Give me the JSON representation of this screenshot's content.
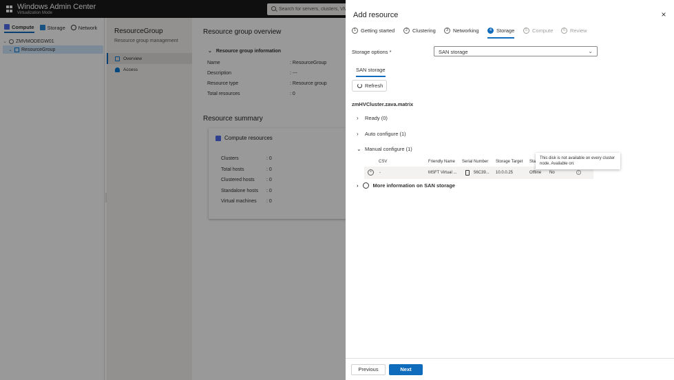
{
  "app": {
    "title": "Windows Admin Center",
    "subtitle": "Virtualization Mode",
    "search_placeholder": "Search for servers, clusters, VMs"
  },
  "left_nav": {
    "tabs": [
      {
        "label": "Compute",
        "icon": "compute-icon",
        "active": true
      },
      {
        "label": "Storage",
        "icon": "storage-icon",
        "active": false
      },
      {
        "label": "Network",
        "icon": "network-icon",
        "active": false
      }
    ],
    "tree": [
      {
        "label": "ZMVMODEGW01",
        "icon": "server-icon",
        "expanded": true
      },
      {
        "label": "ResourceGroup",
        "icon": "resource-group-icon",
        "selected": true
      }
    ]
  },
  "resource_nav": {
    "title": "ResourceGroup",
    "subtitle": "Resource group management",
    "items": [
      {
        "label": "Overview",
        "icon": "overview-icon",
        "active": true
      },
      {
        "label": "Access",
        "icon": "access-icon",
        "active": false
      }
    ]
  },
  "overview": {
    "title": "Resource group overview",
    "info_header": "Resource group information",
    "fields": [
      {
        "key": "Name",
        "value": ": ResourceGroup"
      },
      {
        "key": "Description",
        "value": ": ---"
      },
      {
        "key": "Resource type",
        "value": ": Resource group"
      },
      {
        "key": "Total resources",
        "value": ": 0"
      }
    ],
    "summary_title": "Resource summary",
    "compute_card": {
      "title": "Compute resources",
      "rows": [
        {
          "key": "Clusters",
          "value": ": 0"
        },
        {
          "key": "Total hosts",
          "value": ": 0"
        },
        {
          "key": "Clustered hosts",
          "value": ": 0"
        },
        {
          "key": "Standalone hosts",
          "value": ": 0"
        },
        {
          "key": "Virtual machines",
          "value": ": 0"
        }
      ]
    }
  },
  "panel": {
    "title": "Add resource",
    "close_label": "×",
    "steps": [
      {
        "num": "1",
        "label": "Getting started",
        "state": "done"
      },
      {
        "num": "2",
        "label": "Clustering",
        "state": "done"
      },
      {
        "num": "3",
        "label": "Networking",
        "state": "done"
      },
      {
        "num": "4",
        "label": "Storage",
        "state": "current"
      },
      {
        "num": "5",
        "label": "Compute",
        "state": "disabled"
      },
      {
        "num": "6",
        "label": "Review",
        "state": "disabled"
      }
    ],
    "storage_options_label": "Storage options *",
    "storage_options_value": "SAN storage",
    "tab_label": "SAN storage",
    "refresh_label": "Refresh",
    "cluster_name": "zmHVCluster.zava.matrix",
    "sections": {
      "ready": "Ready (0)",
      "auto": "Auto configure (1)",
      "manual": "Manual configure (1)"
    },
    "table": {
      "headers": [
        "CSV",
        "Friendly Name",
        "Serial Number",
        "Storage Target",
        "Sta"
      ],
      "row": {
        "csv": "-",
        "friendly_name": "MSFT Virtual ...",
        "serial": "56C39...",
        "target": "10.0.0.25",
        "status": "Offline",
        "available": "No"
      }
    },
    "tooltip": "This disk is not available on every cluster node. Available on:",
    "more_info": "More information on SAN storage",
    "previous_label": "Previous",
    "next_label": "Next"
  },
  "colors": {
    "accent": "#0f6cbd",
    "topbar": "#1b1a19",
    "overlay": "rgba(0,0,0,0.40)"
  }
}
